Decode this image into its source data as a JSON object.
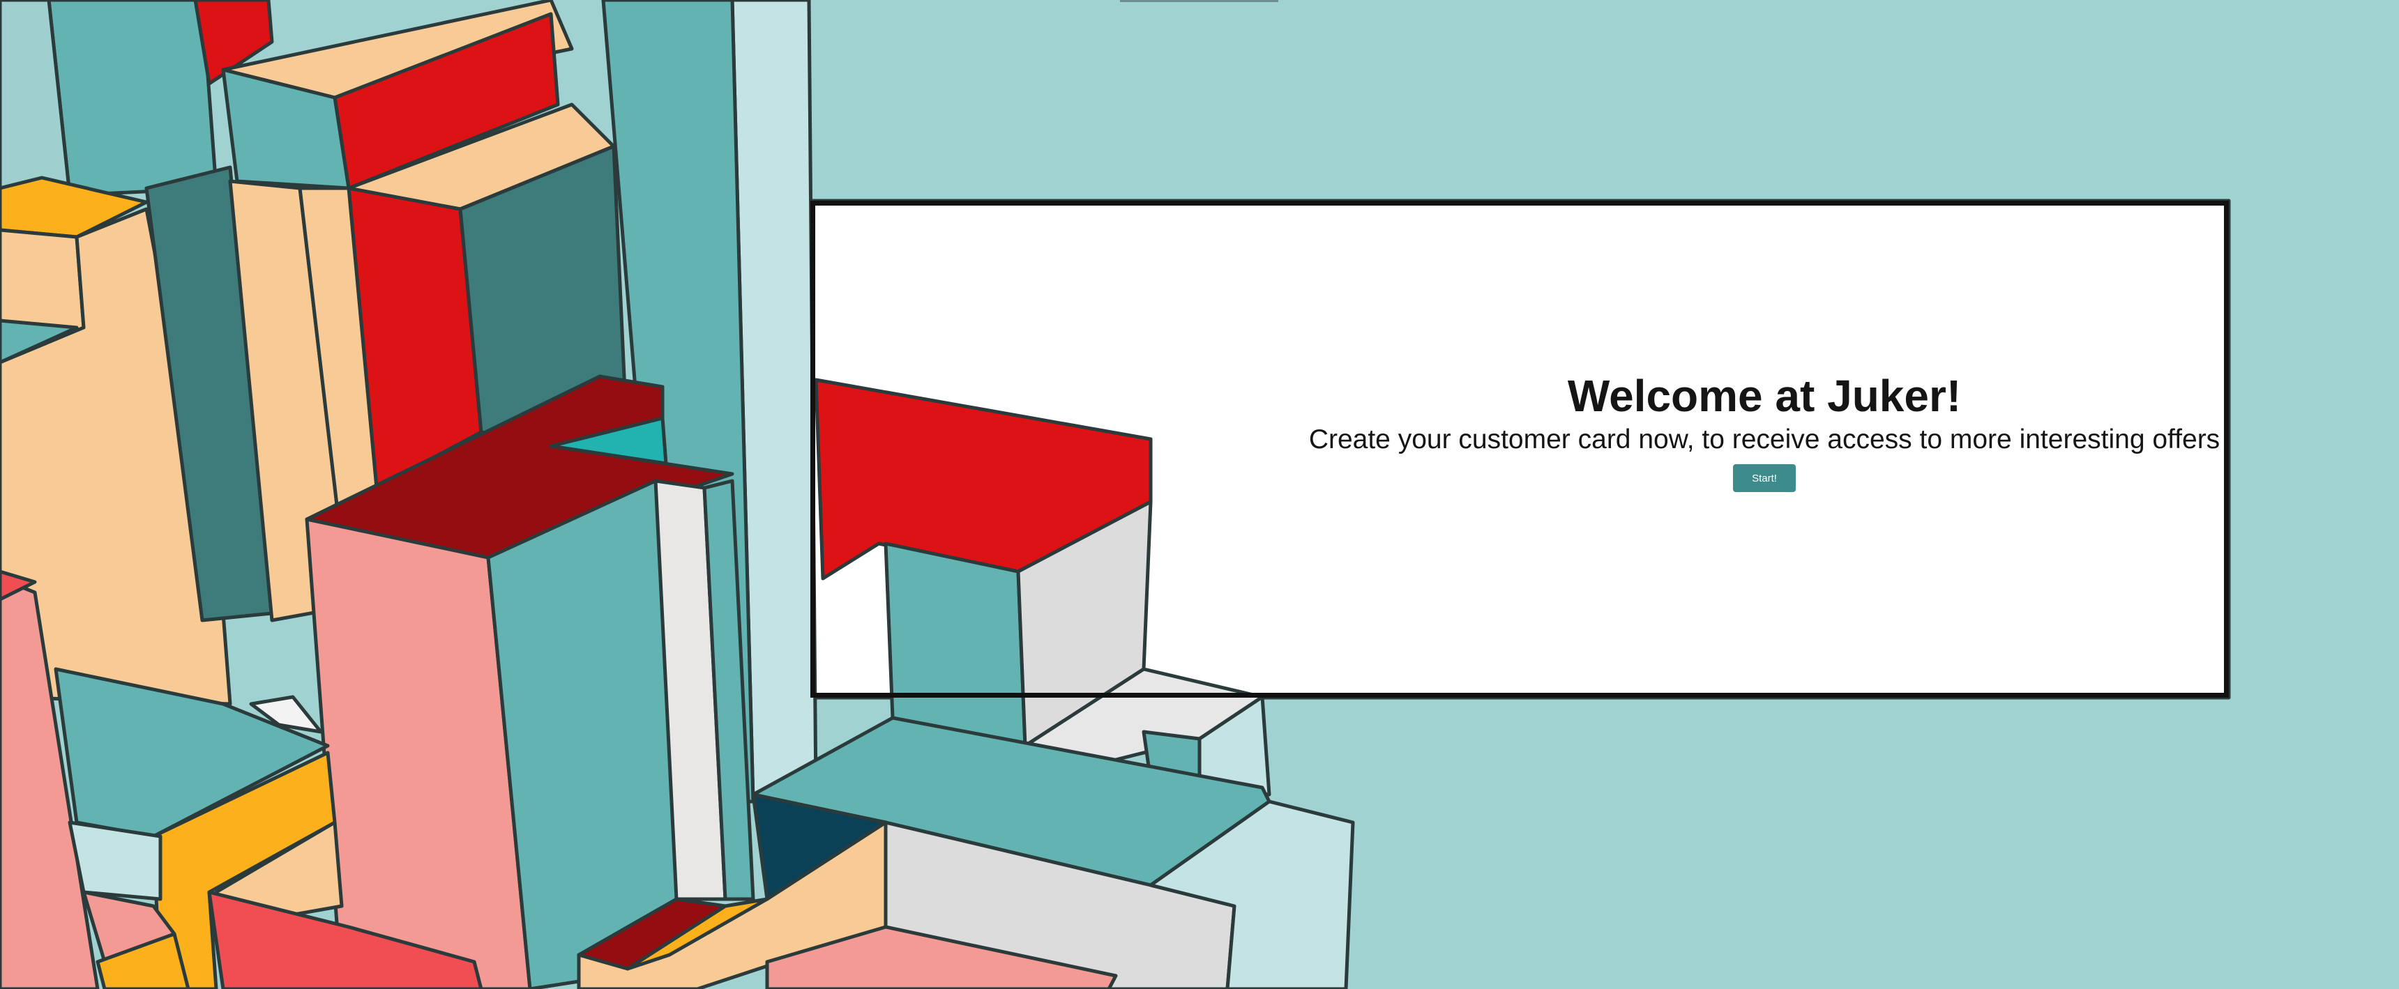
{
  "hero": {
    "title": "Welcome at Juker!",
    "subtitle": "Create your customer card now, to receive access to more interesting offers",
    "start_label": "Start!"
  },
  "colors": {
    "background": "#a0d2d1",
    "panel": "#ffffff",
    "button": "#3e8b8c",
    "red": "#dd1214",
    "orange": "#fbb01c",
    "peach": "#f8cb96",
    "teal": "#63b3b2",
    "dark_teal": "#3d7c7a",
    "pink": "#f29a93",
    "grey": "#dcdcdc"
  }
}
